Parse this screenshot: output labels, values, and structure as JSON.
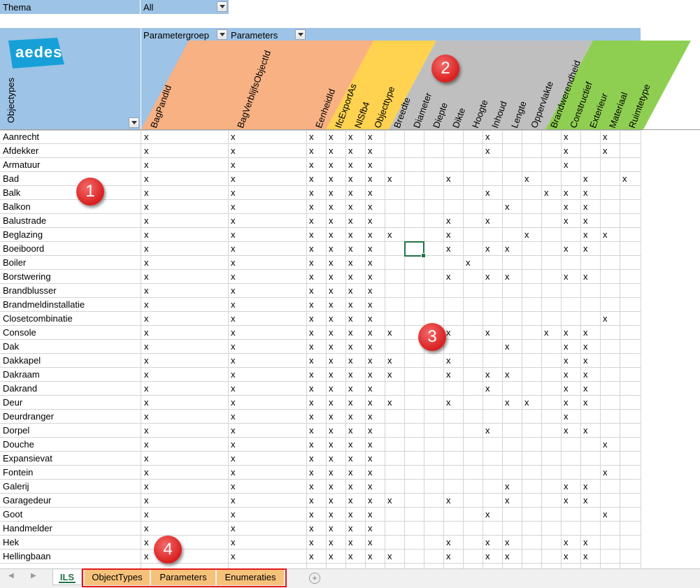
{
  "header": {
    "thema_label": "Thema",
    "thema_value": "All",
    "parametergroep_label": "Parametergroep",
    "parameters_label": "Parameters",
    "objecttypes_label": "Objectypes",
    "logo_text": "aedes"
  },
  "colors": {
    "header_blue": "#9dc3e6",
    "group_orange": "#f8b183",
    "group_yellow": "#ffd24f",
    "group_gray": "#bfbfbf",
    "group_green": "#8ecf52",
    "logo_blue": "#17a0d8",
    "tab_orange": "#f6c27a",
    "tab_outline_red": "#e21b1b",
    "callout_red": "#e02424",
    "active_tab_text": "#217346"
  },
  "columns": [
    "BagPandId",
    "BagVerblijfsObjectId",
    "EenheidId",
    "IfcExportAs",
    "NlSfb4",
    "Objecttype",
    "Breedte",
    "Diameter",
    "Diepte",
    "Dikte",
    "Hoogte",
    "Inhoud",
    "Lengte",
    "Oppervlakte",
    "Brandwerendheid",
    "Constructief",
    "Exterieur",
    "Materiaal",
    "Ruimtetype"
  ],
  "rows": [
    {
      "label": "Aanrecht",
      "marks": "xxxxxx00000x000x0x0"
    },
    {
      "label": "Afdekker",
      "marks": "xxxxxx00000x000x0x0"
    },
    {
      "label": "Armatuur",
      "marks": "xxxxxx000000000x000"
    },
    {
      "label": "Bad",
      "marks": "xxxxxxx00x000x00x0x0"
    },
    {
      "label": "Balk",
      "marks": "xxxxxx00000x00xxx0"
    },
    {
      "label": "Balkon",
      "marks": "xxxxxx000000x00xx0"
    },
    {
      "label": "Balustrade",
      "marks": "xxxxxx000x0x000xx0"
    },
    {
      "label": "Beglazing",
      "marks": "xxxxxxx00x000x00xx0"
    },
    {
      "label": "Boeiboord",
      "marks": "xxxxxx000x0xx00xx0"
    },
    {
      "label": "Boiler",
      "marks": "xxxxxx0000x000000"
    },
    {
      "label": "Borstwering",
      "marks": "xxxxxx000x0xx00xx0"
    },
    {
      "label": "Brandblusser",
      "marks": "xxxxxx0000000000000"
    },
    {
      "label": "Brandmeldinstallatie",
      "marks": "xxxxxx0000000000000"
    },
    {
      "label": "Closetcombinatie",
      "marks": "xxxxxx00000000000x0"
    },
    {
      "label": "Console",
      "marks": "xxxxxxx00x0x00xxx0"
    },
    {
      "label": "Dak",
      "marks": "xxxxxx000000x00xx0"
    },
    {
      "label": "Dakkapel",
      "marks": "xxxxxxx00x00000xx0"
    },
    {
      "label": "Dakraam",
      "marks": "xxxxxxx00x0xx00xx0"
    },
    {
      "label": "Dakrand",
      "marks": "xxxxxx00000x000xx0"
    },
    {
      "label": "Deur",
      "marks": "xxxxxxx00x00xx0xx0"
    },
    {
      "label": "Deurdranger",
      "marks": "xxxxxx000000000x000"
    },
    {
      "label": "Dorpel",
      "marks": "xxxxxx00000x000xx0"
    },
    {
      "label": "Douche",
      "marks": "xxxxxx00000000000x0"
    },
    {
      "label": "Expansievat",
      "marks": "xxxxxx0000000000000"
    },
    {
      "label": "Fontein",
      "marks": "xxxxxx00000000000x0"
    },
    {
      "label": "Galerij",
      "marks": "xxxxxx000000x00xx0"
    },
    {
      "label": "Garagedeur",
      "marks": "xxxxxxx00x00x00xx0"
    },
    {
      "label": "Goot",
      "marks": "xxxxxx00000x00000x0"
    },
    {
      "label": "Handmelder",
      "marks": "xxxxxx0000000000000"
    },
    {
      "label": "Hek",
      "marks": "xxxxxx000x0xx00xx0"
    },
    {
      "label": "Hellingbaan",
      "marks": "xxxxxxx00x0xx00xx0"
    }
  ],
  "tabs": {
    "active": "ILS",
    "others": [
      "ObjectTypes",
      "Parameters",
      "Enumeraties"
    ]
  },
  "callouts": [
    "1",
    "2",
    "3",
    "4"
  ],
  "icons": [
    "filter-dropdown-icon",
    "add-sheet-icon",
    "scroll-left-icon",
    "scroll-right-icon"
  ]
}
